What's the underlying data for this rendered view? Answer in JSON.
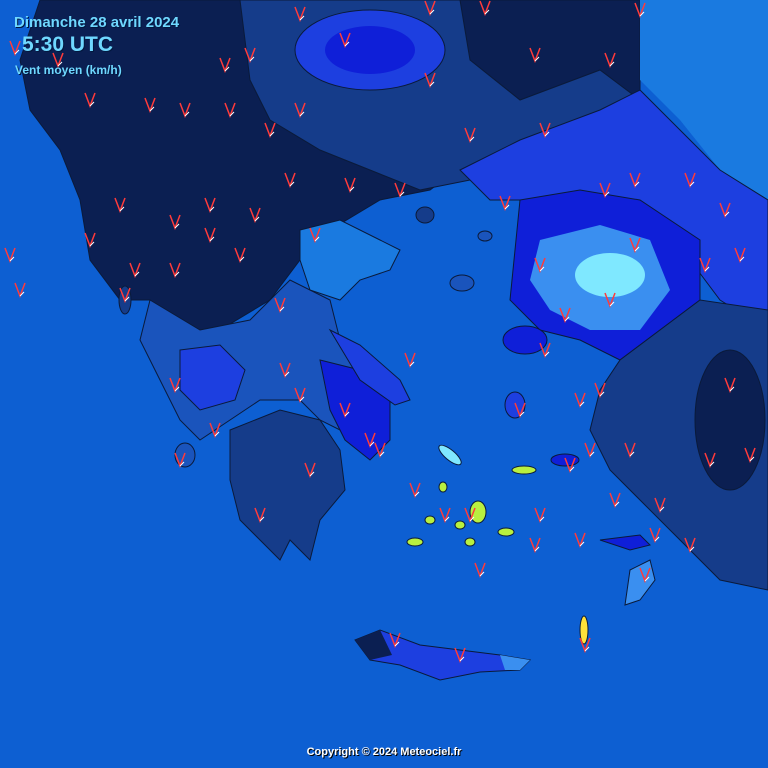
{
  "header": {
    "date": "Dimanche 28 avril 2024",
    "time": "5:30 UTC",
    "variable": "Vent moyen (km/h)"
  },
  "footer": {
    "copyright": "Copyright © 2024 Meteociel.fr"
  },
  "colors": {
    "sea": "#0d5fd2",
    "wind_very_light": "#0b1f52",
    "wind_light": "#153c8a",
    "wind_moderate": "#1a54bc",
    "wind_strong": "#1d3fe0",
    "wind_very_strong": "#0f1fd8",
    "gust_zone": "#3a8ff0",
    "peak_zone": "#7fe8ff",
    "high_wind_island": "#b8f040",
    "barb_color": "#ff3b3b",
    "borders": "#0a1a3a"
  }
}
